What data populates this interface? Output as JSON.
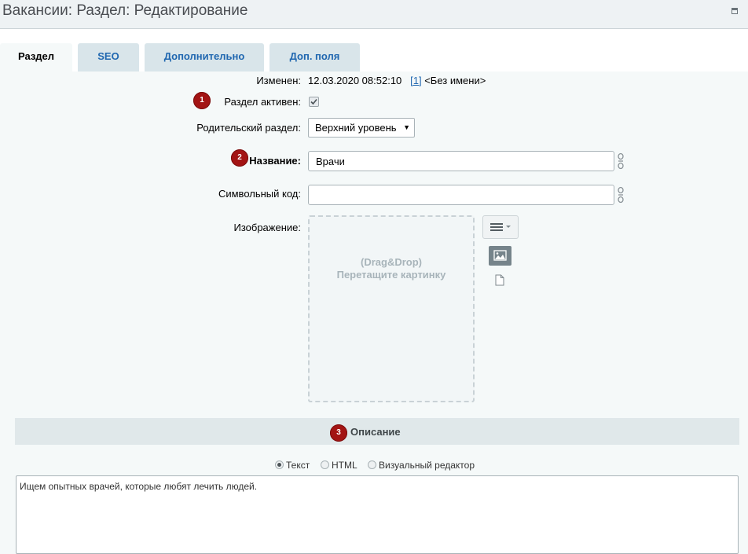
{
  "window": {
    "title": "Вакансии: Раздел: Редактирование"
  },
  "tabs": [
    {
      "label": "Раздел",
      "active": true
    },
    {
      "label": "SEO",
      "active": false
    },
    {
      "label": "Дополнительно",
      "active": false
    },
    {
      "label": "Доп. поля",
      "active": false
    }
  ],
  "form": {
    "modified": {
      "label": "Изменен:",
      "datetime": "12.03.2020 08:52:10",
      "user_link": "[1]",
      "user_name": "<Без имени>"
    },
    "active": {
      "label": "Раздел активен:",
      "checked": true,
      "badge": "1"
    },
    "parent": {
      "label": "Родительский раздел:",
      "selected": "Верхний уровень"
    },
    "name": {
      "label": "Название:",
      "value": "Врачи",
      "badge": "2"
    },
    "code": {
      "label": "Символьный код:",
      "value": ""
    },
    "image": {
      "label": "Изображение:",
      "drop_line1": "(Drag&Drop)",
      "drop_line2": "Перетащите картинку"
    }
  },
  "description_section": {
    "title": "Описание",
    "badge": "3",
    "modes": [
      {
        "label": "Текст",
        "selected": true
      },
      {
        "label": "HTML",
        "selected": false
      },
      {
        "label": "Визуальный редактор",
        "selected": false
      }
    ],
    "text": "Ищем опытных врачей, которые любят лечить людей."
  },
  "icons": {
    "window_maximize": "maximize-icon",
    "link_toggle": "chain-link-icon",
    "menu": "hamburger-menu-icon",
    "image_library": "image-icon",
    "file": "document-icon"
  },
  "colors": {
    "link": "#2067b0",
    "badge": "#a31414",
    "tab_inactive": "#d9e5ea",
    "page_bg": "#f5f9f9"
  }
}
